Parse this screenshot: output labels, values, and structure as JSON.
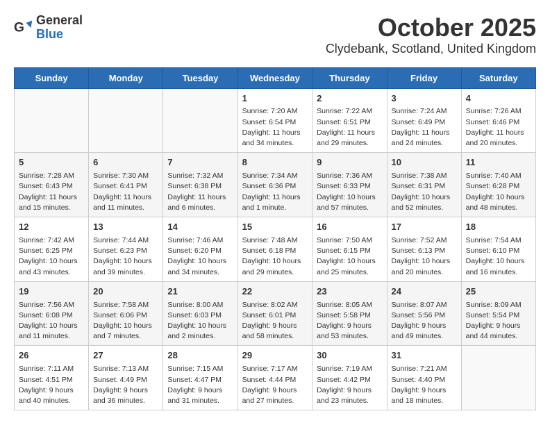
{
  "logo": {
    "general": "General",
    "blue": "Blue"
  },
  "title": "October 2025",
  "subtitle": "Clydebank, Scotland, United Kingdom",
  "days_of_week": [
    "Sunday",
    "Monday",
    "Tuesday",
    "Wednesday",
    "Thursday",
    "Friday",
    "Saturday"
  ],
  "weeks": [
    [
      {
        "day": "",
        "info": ""
      },
      {
        "day": "",
        "info": ""
      },
      {
        "day": "",
        "info": ""
      },
      {
        "day": "1",
        "info": "Sunrise: 7:20 AM\nSunset: 6:54 PM\nDaylight: 11 hours\nand 34 minutes."
      },
      {
        "day": "2",
        "info": "Sunrise: 7:22 AM\nSunset: 6:51 PM\nDaylight: 11 hours\nand 29 minutes."
      },
      {
        "day": "3",
        "info": "Sunrise: 7:24 AM\nSunset: 6:49 PM\nDaylight: 11 hours\nand 24 minutes."
      },
      {
        "day": "4",
        "info": "Sunrise: 7:26 AM\nSunset: 6:46 PM\nDaylight: 11 hours\nand 20 minutes."
      }
    ],
    [
      {
        "day": "5",
        "info": "Sunrise: 7:28 AM\nSunset: 6:43 PM\nDaylight: 11 hours\nand 15 minutes."
      },
      {
        "day": "6",
        "info": "Sunrise: 7:30 AM\nSunset: 6:41 PM\nDaylight: 11 hours\nand 11 minutes."
      },
      {
        "day": "7",
        "info": "Sunrise: 7:32 AM\nSunset: 6:38 PM\nDaylight: 11 hours\nand 6 minutes."
      },
      {
        "day": "8",
        "info": "Sunrise: 7:34 AM\nSunset: 6:36 PM\nDaylight: 11 hours\nand 1 minute."
      },
      {
        "day": "9",
        "info": "Sunrise: 7:36 AM\nSunset: 6:33 PM\nDaylight: 10 hours\nand 57 minutes."
      },
      {
        "day": "10",
        "info": "Sunrise: 7:38 AM\nSunset: 6:31 PM\nDaylight: 10 hours\nand 52 minutes."
      },
      {
        "day": "11",
        "info": "Sunrise: 7:40 AM\nSunset: 6:28 PM\nDaylight: 10 hours\nand 48 minutes."
      }
    ],
    [
      {
        "day": "12",
        "info": "Sunrise: 7:42 AM\nSunset: 6:25 PM\nDaylight: 10 hours\nand 43 minutes."
      },
      {
        "day": "13",
        "info": "Sunrise: 7:44 AM\nSunset: 6:23 PM\nDaylight: 10 hours\nand 39 minutes."
      },
      {
        "day": "14",
        "info": "Sunrise: 7:46 AM\nSunset: 6:20 PM\nDaylight: 10 hours\nand 34 minutes."
      },
      {
        "day": "15",
        "info": "Sunrise: 7:48 AM\nSunset: 6:18 PM\nDaylight: 10 hours\nand 29 minutes."
      },
      {
        "day": "16",
        "info": "Sunrise: 7:50 AM\nSunset: 6:15 PM\nDaylight: 10 hours\nand 25 minutes."
      },
      {
        "day": "17",
        "info": "Sunrise: 7:52 AM\nSunset: 6:13 PM\nDaylight: 10 hours\nand 20 minutes."
      },
      {
        "day": "18",
        "info": "Sunrise: 7:54 AM\nSunset: 6:10 PM\nDaylight: 10 hours\nand 16 minutes."
      }
    ],
    [
      {
        "day": "19",
        "info": "Sunrise: 7:56 AM\nSunset: 6:08 PM\nDaylight: 10 hours\nand 11 minutes."
      },
      {
        "day": "20",
        "info": "Sunrise: 7:58 AM\nSunset: 6:06 PM\nDaylight: 10 hours\nand 7 minutes."
      },
      {
        "day": "21",
        "info": "Sunrise: 8:00 AM\nSunset: 6:03 PM\nDaylight: 10 hours\nand 2 minutes."
      },
      {
        "day": "22",
        "info": "Sunrise: 8:02 AM\nSunset: 6:01 PM\nDaylight: 9 hours\nand 58 minutes."
      },
      {
        "day": "23",
        "info": "Sunrise: 8:05 AM\nSunset: 5:58 PM\nDaylight: 9 hours\nand 53 minutes."
      },
      {
        "day": "24",
        "info": "Sunrise: 8:07 AM\nSunset: 5:56 PM\nDaylight: 9 hours\nand 49 minutes."
      },
      {
        "day": "25",
        "info": "Sunrise: 8:09 AM\nSunset: 5:54 PM\nDaylight: 9 hours\nand 44 minutes."
      }
    ],
    [
      {
        "day": "26",
        "info": "Sunrise: 7:11 AM\nSunset: 4:51 PM\nDaylight: 9 hours\nand 40 minutes."
      },
      {
        "day": "27",
        "info": "Sunrise: 7:13 AM\nSunset: 4:49 PM\nDaylight: 9 hours\nand 36 minutes."
      },
      {
        "day": "28",
        "info": "Sunrise: 7:15 AM\nSunset: 4:47 PM\nDaylight: 9 hours\nand 31 minutes."
      },
      {
        "day": "29",
        "info": "Sunrise: 7:17 AM\nSunset: 4:44 PM\nDaylight: 9 hours\nand 27 minutes."
      },
      {
        "day": "30",
        "info": "Sunrise: 7:19 AM\nSunset: 4:42 PM\nDaylight: 9 hours\nand 23 minutes."
      },
      {
        "day": "31",
        "info": "Sunrise: 7:21 AM\nSunset: 4:40 PM\nDaylight: 9 hours\nand 18 minutes."
      },
      {
        "day": "",
        "info": ""
      }
    ]
  ]
}
